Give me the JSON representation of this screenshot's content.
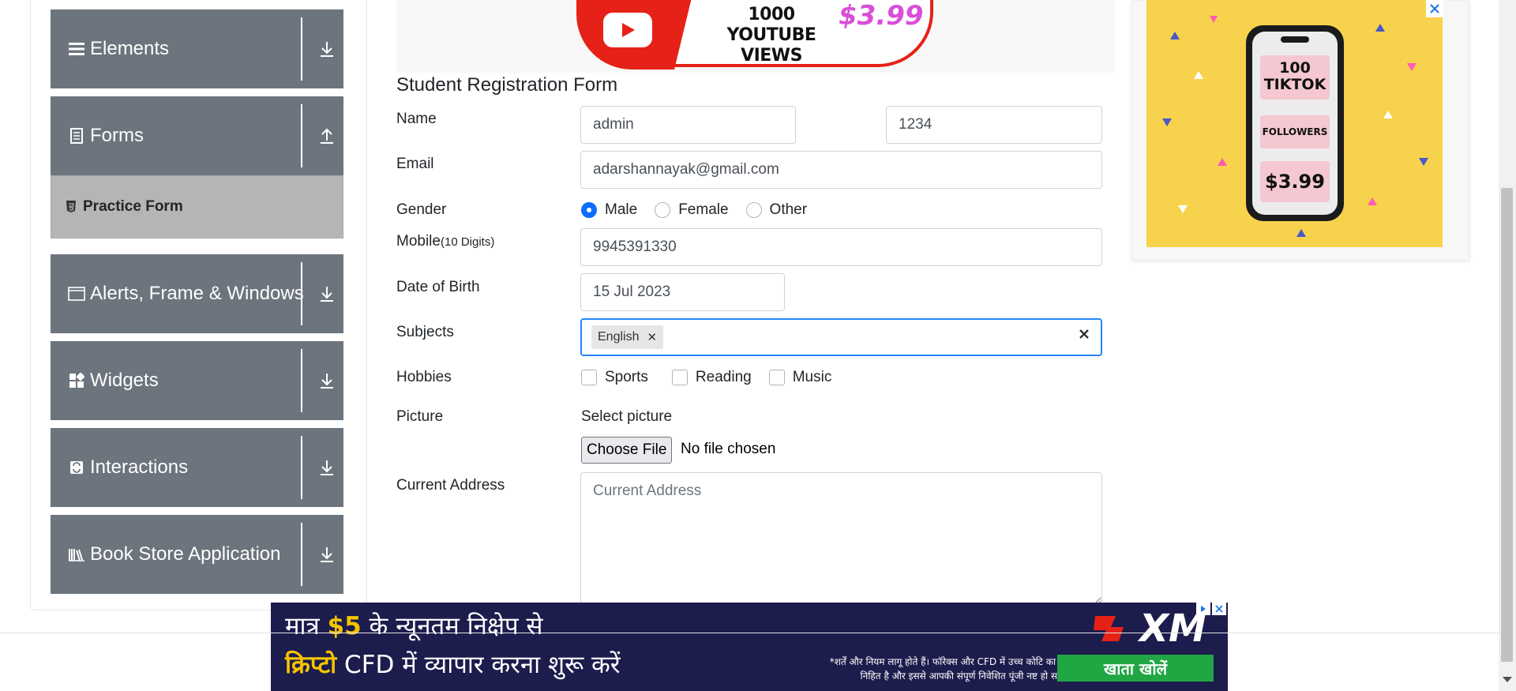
{
  "sidebar": {
    "groups": [
      {
        "label": "Elements",
        "icon": "hamburger-icon",
        "arrow": "download-arrow-icon"
      },
      {
        "label": "Forms",
        "icon": "document-icon",
        "arrow": "upload-arrow-icon"
      },
      {
        "label": "Alerts, Frame & Windows",
        "icon": "window-icon",
        "arrow": "download-arrow-icon"
      },
      {
        "label": "Widgets",
        "icon": "widgets-icon",
        "arrow": "download-arrow-icon"
      },
      {
        "label": "Interactions",
        "icon": "interactions-icon",
        "arrow": "download-arrow-icon"
      },
      {
        "label": "Book Store Application",
        "icon": "books-icon",
        "arrow": "download-arrow-icon"
      }
    ],
    "active_item": {
      "label": "Practice Form",
      "icon": "html5-icon"
    }
  },
  "top_banner": {
    "count": "1000",
    "text": "YOUTUBE VIEWS",
    "price": "$3.99",
    "brand_color": "#e62117"
  },
  "form": {
    "title": "Student Registration Form",
    "name": {
      "label": "Name",
      "first_value": "admin",
      "last_value": "1234"
    },
    "email": {
      "label": "Email",
      "value": "adarshannayak@gmail.com"
    },
    "gender": {
      "label": "Gender",
      "options": [
        "Male",
        "Female",
        "Other"
      ],
      "selected": "Male"
    },
    "mobile": {
      "label": "Mobile",
      "hint": "(10 Digits)",
      "value": "9945391330"
    },
    "dob": {
      "label": "Date of Birth",
      "value": "15 Jul 2023"
    },
    "subjects": {
      "label": "Subjects",
      "chips": [
        "English"
      ]
    },
    "hobbies": {
      "label": "Hobbies",
      "options": [
        "Sports",
        "Reading",
        "Music"
      ]
    },
    "picture": {
      "label": "Picture",
      "prompt": "Select picture",
      "button": "Choose File",
      "status": "No file chosen"
    },
    "address": {
      "label": "Current Address",
      "placeholder": "Current Address"
    },
    "accent_color": "#0d6efd",
    "focus_color": "#2684ff"
  },
  "side_ad": {
    "line1": "100",
    "line2": "TIKTOK",
    "line3": "FOLLOWERS",
    "price": "$3.99",
    "background": "#f7d24c"
  },
  "bottom_ad": {
    "line1_pre": "मात्र ",
    "line1_amount": "$5",
    "line1_post": " के न्यूनतम निक्षेप से",
    "line2_highlight": "क्रिप्टो",
    "line2_rest": " CFD में व्यापार करना शुरू करें",
    "disclaimer_1": "*शर्तें और नियम लागू होते हैं। फॉरेक्स और CFD में उच्च कोटि का जोखिम",
    "disclaimer_2": "निहित है और इससे आपकी संपूर्ण निवेशित पूंजी नष्ट हो सकती है।",
    "brand": "XM",
    "cta": "खाता खोलें",
    "background": "#1c1c4d",
    "cta_color": "#21a644"
  }
}
